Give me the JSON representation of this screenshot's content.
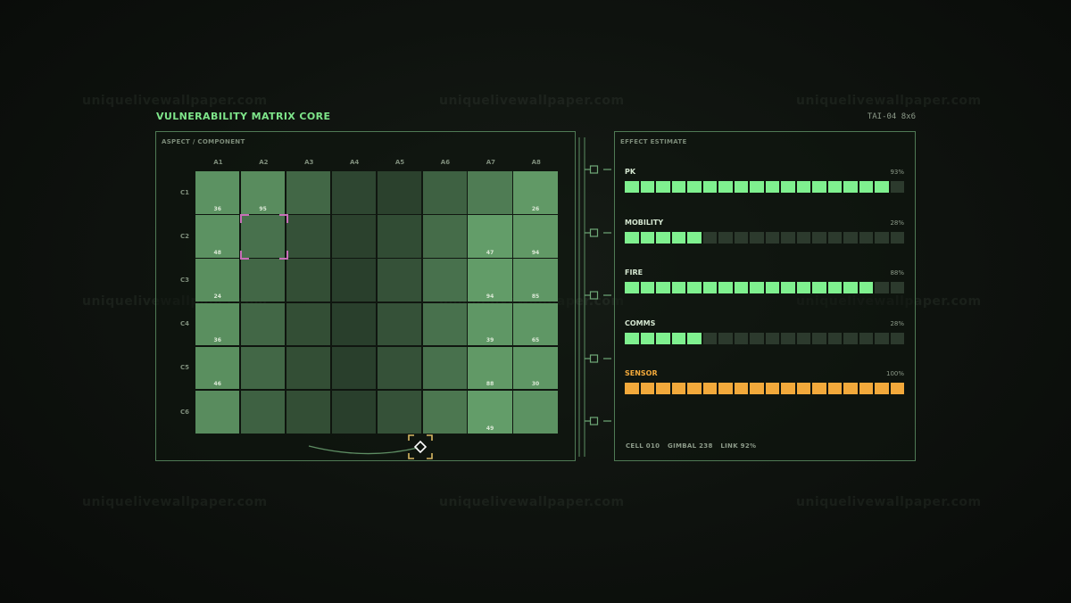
{
  "watermark": "uniquelivewallpaper.com",
  "header": {
    "title": "VULNERABILITY MATRIX CORE",
    "tag": "TAI-04  8x6"
  },
  "matrix": {
    "label": "ASPECT / COMPONENT",
    "columns": [
      "A1",
      "A2",
      "A3",
      "A4",
      "A5",
      "A6",
      "A7",
      "A8"
    ],
    "rows": [
      "C1",
      "C2",
      "C3",
      "C4",
      "C5",
      "C6"
    ],
    "levels": [
      [
        0.85,
        0.8,
        0.45,
        0.15,
        0.1,
        0.4,
        0.65,
        0.92
      ],
      [
        0.85,
        0.55,
        0.25,
        0.1,
        0.2,
        0.5,
        0.95,
        0.92
      ],
      [
        0.82,
        0.45,
        0.22,
        0.08,
        0.25,
        0.55,
        0.94,
        0.9
      ],
      [
        0.82,
        0.45,
        0.22,
        0.08,
        0.25,
        0.55,
        0.9,
        0.9
      ],
      [
        0.82,
        0.45,
        0.22,
        0.08,
        0.25,
        0.55,
        0.92,
        0.9
      ],
      [
        0.8,
        0.4,
        0.22,
        0.08,
        0.25,
        0.6,
        0.95,
        0.85
      ]
    ],
    "values": [
      [
        "36",
        "95",
        "",
        "",
        "",
        "",
        "",
        "26"
      ],
      [
        "48",
        "",
        "",
        "",
        "",
        "",
        "47",
        "94"
      ],
      [
        "24",
        "",
        "",
        "",
        "",
        "",
        "94",
        "85"
      ],
      [
        "36",
        "",
        "",
        "",
        "",
        "",
        "39",
        "65"
      ],
      [
        "46",
        "",
        "",
        "",
        "",
        "",
        "88",
        "30"
      ],
      [
        "",
        "",
        "",
        "",
        "",
        "",
        "49",
        ""
      ]
    ],
    "selected": {
      "row": 1,
      "col": 1
    }
  },
  "effects": {
    "label": "EFFECT ESTIMATE",
    "items": [
      {
        "name": "PK",
        "pct": "93%",
        "filled": 17,
        "color": "#7ff08f"
      },
      {
        "name": "MOBILITY",
        "pct": "28%",
        "filled": 5,
        "color": "#7ff08f"
      },
      {
        "name": "FIRE",
        "pct": "88%",
        "filled": 16,
        "color": "#7ff08f"
      },
      {
        "name": "COMMS",
        "pct": "28%",
        "filled": 5,
        "color": "#7ff08f"
      },
      {
        "name": "SENSOR",
        "pct": "100%",
        "filled": 18,
        "color": "#f2a93b"
      }
    ],
    "segments": 18,
    "status": {
      "cell": "CELL 010",
      "gimbal": "GIMBAL 238",
      "link": "LINK 92%"
    }
  },
  "colors": {
    "accent": "#7ee58a",
    "border": "#4f7a55",
    "warn": "#f2a93b",
    "select": "#c86fb8",
    "reticle": "#d8b863"
  }
}
